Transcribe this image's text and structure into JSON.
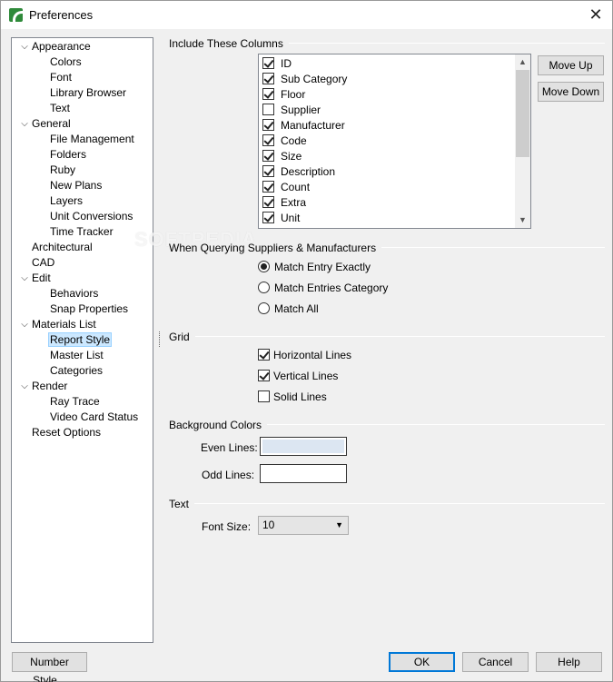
{
  "window": {
    "title": "Preferences",
    "close_glyph": "✕"
  },
  "watermark": "SOFTPEDIA",
  "tree": [
    {
      "label": "Appearance",
      "level": 0,
      "expanded": true,
      "top": 0
    },
    {
      "label": "Colors",
      "level": 1
    },
    {
      "label": "Font",
      "level": 1
    },
    {
      "label": "Library Browser",
      "level": 1
    },
    {
      "label": "Text",
      "level": 1
    },
    {
      "label": "General",
      "level": 0,
      "expanded": true
    },
    {
      "label": "File Management",
      "level": 1
    },
    {
      "label": "Folders",
      "level": 1
    },
    {
      "label": "Ruby",
      "level": 1
    },
    {
      "label": "New Plans",
      "level": 1
    },
    {
      "label": "Layers",
      "level": 1
    },
    {
      "label": "Unit Conversions",
      "level": 1
    },
    {
      "label": "Time Tracker",
      "level": 1
    },
    {
      "label": "Architectural",
      "level": 0
    },
    {
      "label": "CAD",
      "level": 0
    },
    {
      "label": "Edit",
      "level": 0,
      "expanded": true
    },
    {
      "label": "Behaviors",
      "level": 1
    },
    {
      "label": "Snap Properties",
      "level": 1
    },
    {
      "label": "Materials List",
      "level": 0,
      "expanded": true
    },
    {
      "label": "Report Style",
      "level": 1,
      "selected": true
    },
    {
      "label": "Master List",
      "level": 1
    },
    {
      "label": "Categories",
      "level": 1
    },
    {
      "label": "Render",
      "level": 0,
      "expanded": true
    },
    {
      "label": "Ray Trace",
      "level": 1
    },
    {
      "label": "Video Card Status",
      "level": 1
    },
    {
      "label": "Reset Options",
      "level": 0
    }
  ],
  "columns": {
    "title": "Include These Columns",
    "items": [
      {
        "label": "ID",
        "checked": true
      },
      {
        "label": "Sub Category",
        "checked": true
      },
      {
        "label": "Floor",
        "checked": true
      },
      {
        "label": "Supplier",
        "checked": false
      },
      {
        "label": "Manufacturer",
        "checked": true
      },
      {
        "label": "Code",
        "checked": true
      },
      {
        "label": "Size",
        "checked": true
      },
      {
        "label": "Description",
        "checked": true
      },
      {
        "label": "Count",
        "checked": true
      },
      {
        "label": "Extra",
        "checked": true
      },
      {
        "label": "Unit",
        "checked": true
      }
    ],
    "move_up": "Move Up",
    "move_down": "Move Down"
  },
  "querying": {
    "title": "When Querying Suppliers & Manufacturers",
    "options": [
      {
        "label": "Match Entry Exactly",
        "checked": true
      },
      {
        "label": "Match Entries Category",
        "checked": false
      },
      {
        "label": "Match All",
        "checked": false
      }
    ]
  },
  "grid": {
    "title": "Grid",
    "options": [
      {
        "label": "Horizontal Lines",
        "checked": true
      },
      {
        "label": "Vertical Lines",
        "checked": true
      },
      {
        "label": "Solid Lines",
        "checked": false
      }
    ]
  },
  "background": {
    "title": "Background Colors",
    "even_label": "Even Lines:",
    "odd_label": "Odd Lines:",
    "even_color": "#dce6f2",
    "odd_color": "#ffffff"
  },
  "text_group": {
    "title": "Text",
    "font_size_label": "Font Size:",
    "font_size_value": "10"
  },
  "footer": {
    "number_style": "Number Style...",
    "ok": "OK",
    "cancel": "Cancel",
    "help": "Help"
  }
}
